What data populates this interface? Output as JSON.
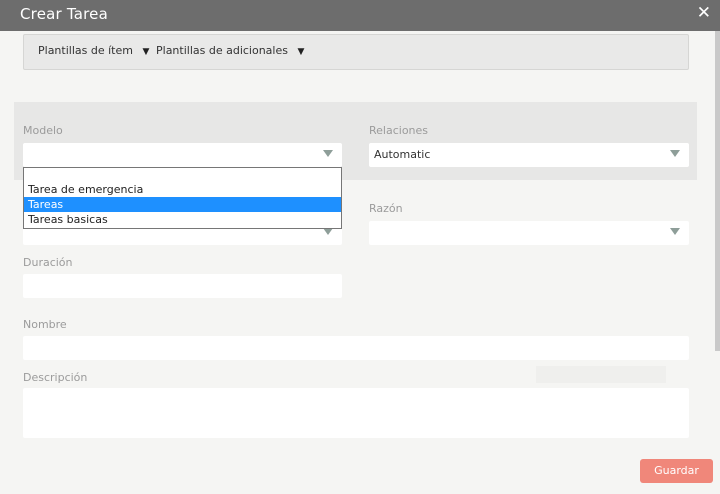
{
  "window": {
    "title": "Crear Tarea",
    "close_glyph": "✕"
  },
  "toolbar": {
    "item_templates": "Plantillas de ítem",
    "additional_templates": "Plantillas de adicionales",
    "caret_glyph": "▼"
  },
  "form": {
    "modelo": {
      "label": "Modelo",
      "value": ""
    },
    "relaciones": {
      "label": "Relaciones",
      "value": "Automatic"
    },
    "razon": {
      "label": "Razón",
      "value": ""
    },
    "duracion": {
      "label": "Duración",
      "value": ""
    },
    "nombre": {
      "label": "Nombre",
      "value": ""
    },
    "descripcion": {
      "label": "Descripción",
      "value": ""
    }
  },
  "modelo_dropdown": {
    "options": [
      "",
      "Tarea de emergencia",
      "Tareas",
      "Tareas basicas"
    ],
    "selected": "Tareas"
  },
  "actions": {
    "save_label": "Guardar"
  },
  "colors": {
    "titlebar": "#6d6d6d",
    "save_button": "#f0877a",
    "selected_option": "#1e90ff",
    "label_text": "#9b9b9b"
  }
}
